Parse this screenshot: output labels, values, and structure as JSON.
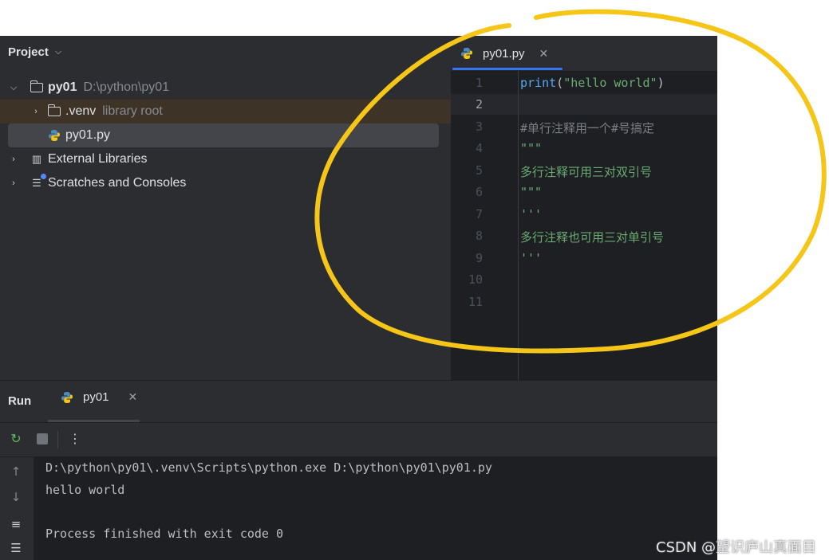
{
  "project": {
    "header": "Project",
    "tree": [
      {
        "label": "py01",
        "hint": "D:\\python\\py01"
      },
      {
        "label": ".venv",
        "hint": "library root"
      },
      {
        "label": "py01.py"
      },
      {
        "label": "External Libraries"
      },
      {
        "label": "Scratches and Consoles"
      }
    ]
  },
  "editor": {
    "tab_label": "py01.py",
    "line_numbers": [
      "1",
      "2",
      "3",
      "4",
      "5",
      "6",
      "7",
      "8",
      "9",
      "10",
      "11"
    ],
    "current_line": 2,
    "code": {
      "l1_fn": "print",
      "l1_open": "(",
      "l1_str": "\"hello world\"",
      "l1_close": ")",
      "l3": "#单行注释用一个#号搞定",
      "l4": "\"\"\"",
      "l5": "多行注释可用三对双引号",
      "l6": "\"\"\"",
      "l7": "'''",
      "l8": "多行注释也可用三对单引号",
      "l9": "'''"
    }
  },
  "run": {
    "title": "Run",
    "tab_label": "py01",
    "console": [
      "D:\\python\\py01\\.venv\\Scripts\\python.exe D:\\python\\py01\\py01.py",
      "hello world",
      "",
      "Process finished with exit code 0"
    ]
  },
  "watermark": "CSDN @望识庐山真面目",
  "colors": {
    "accent": "#3574f0",
    "annotation": "#f5c518",
    "string": "#6aab73",
    "comment": "#7a7e85"
  },
  "icons": [
    "chevron-down-icon",
    "chevron-right-icon",
    "folder-icon",
    "python-file-icon",
    "library-icon",
    "scratches-icon",
    "close-icon",
    "rerun-icon",
    "stop-icon",
    "more-icon",
    "up-arrow-icon",
    "down-arrow-icon",
    "soft-wrap-icon",
    "scroll-to-end-icon"
  ]
}
